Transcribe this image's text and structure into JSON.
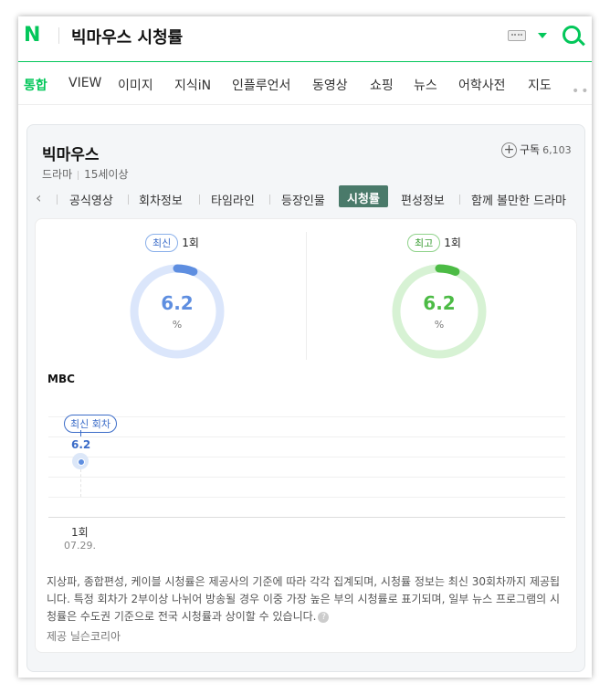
{
  "header": {
    "logo": "N",
    "query": "빅마우스 시청률"
  },
  "nav": {
    "items": [
      "통합",
      "VIEW",
      "이미지",
      "지식iN",
      "인플루언서",
      "동영상",
      "쇼핑",
      "뉴스",
      "어학사전",
      "지도"
    ],
    "active_index": 0,
    "more": "•••"
  },
  "card": {
    "title": "빅마우스",
    "genre": "드라마",
    "rating": "15세이상",
    "subscribe_label": "구독",
    "subscribe_count": "6,103",
    "tabs": [
      "공식영상",
      "회차정보",
      "타임라인",
      "등장인물",
      "시청률",
      "편성정보",
      "함께 볼만한 드라마"
    ],
    "active_tab_index": 4
  },
  "ratings": {
    "latest": {
      "badge": "최신",
      "episode": "1회",
      "value": "6.2",
      "unit": "%",
      "fraction": 0.062,
      "color": "#5e8ee0"
    },
    "highest": {
      "badge": "최고",
      "episode": "1회",
      "value": "6.2",
      "unit": "%",
      "fraction": 0.062,
      "color": "#4cbb45"
    }
  },
  "chart": {
    "broadcaster": "MBC",
    "latest_label": "최신 회차",
    "point_label": "6.2",
    "x_tick": "1회",
    "x_date": "07.29."
  },
  "chart_data": {
    "type": "line",
    "categories": [
      "1회"
    ],
    "dates": [
      "07.29."
    ],
    "series": [
      {
        "values": [
          6.2
        ]
      }
    ]
  },
  "footer": {
    "note": "지상파, 종합편성, 케이블 시청률은 제공사의 기준에 따라 각각 집계되며, 시청률 정보는 최신 30회차까지 제공됩니다. 특정 회차가 2부이상 나뉘어 방송될 경우 이중 가장 높은 부의 시청률로 표기되며, 일부 뉴스 프로그램의 시청률은 수도권 기준으로 전국 시청률과 상이할 수 있습니다.",
    "help": "?",
    "provider": "제공 닐슨코리아"
  }
}
